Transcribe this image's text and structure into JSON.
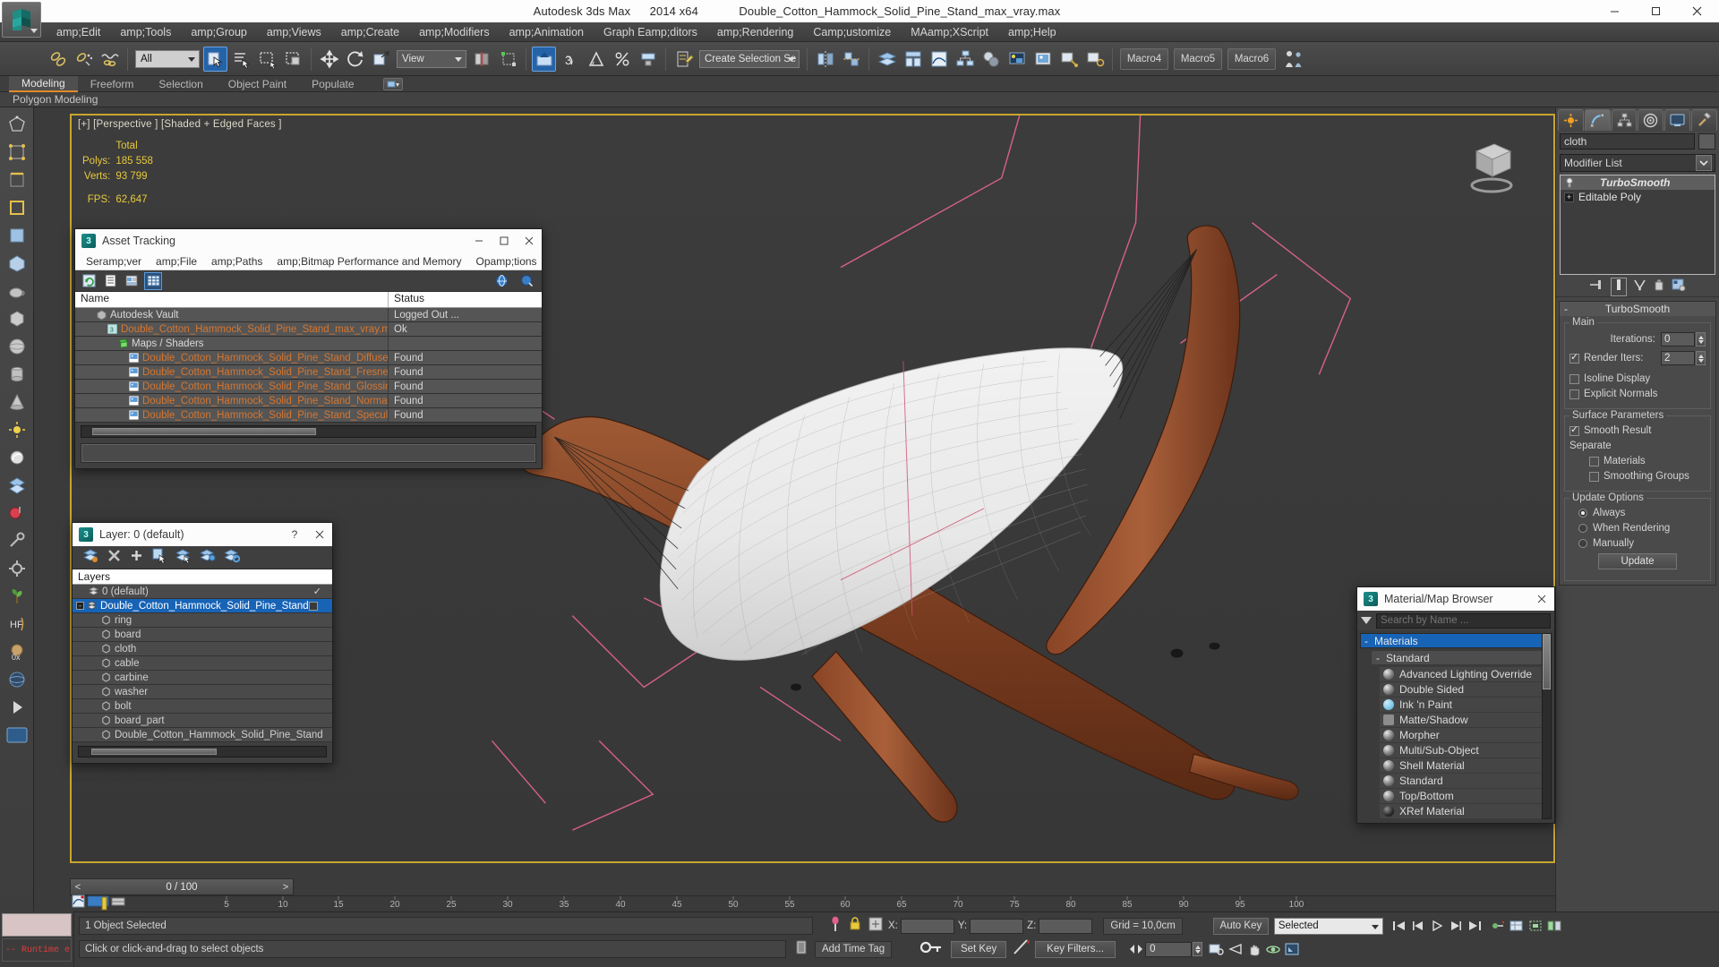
{
  "window": {
    "app_title": "Autodesk 3ds Max",
    "version": "2014 x64",
    "file_title": "Double_Cotton_Hammock_Solid_Pine_Stand_max_vray.max",
    "minimize": "—",
    "maximize": "▢",
    "close": "✕"
  },
  "menubar": {
    "items": [
      "amp;Edit",
      "amp;Tools",
      "amp;Group",
      "amp;Views",
      "amp;Create",
      "amp;Modifiers",
      "amp;Animation",
      "Graph Eamp;ditors",
      "amp;Rendering",
      "Camp;ustomize",
      "MAamp;XScript",
      "amp;Help"
    ]
  },
  "toolbar": {
    "selection_filter": "All",
    "reference_coord": "View",
    "named_selection_placeholder": "Create Selection Se",
    "macro_buttons": [
      "Macro4",
      "Macro5",
      "Macro6"
    ],
    "icons": [
      "link-icon",
      "unlink-icon",
      "bind-space-warp-icon",
      "select-object-icon",
      "select-by-name-icon",
      "rect-selection-region-icon",
      "window-crossing-icon",
      "select-and-move-icon",
      "select-and-rotate-icon",
      "select-and-scale-icon",
      "use-pivot-center-icon",
      "select-and-manipulate-icon",
      "snap-toggle-icon",
      "angle-snap-icon",
      "percent-snap-icon",
      "spinner-snap-icon",
      "edit-named-selection-icon",
      "mirror-icon",
      "align-icon",
      "layer-manager-icon",
      "graphite-tools-icon",
      "curve-editor-icon",
      "schematic-view-icon",
      "material-editor-icon",
      "render-setup-icon",
      "rendered-frame-icon",
      "render-production-icon",
      "render-iterative-icon"
    ]
  },
  "ribbon": {
    "tabs": [
      "Modeling",
      "Freeform",
      "Selection",
      "Object Paint",
      "Populate"
    ],
    "selected_tab": "Modeling",
    "panel_label": "Polygon Modeling"
  },
  "viewport": {
    "label": "[+] [Perspective ] [Shaded + Edged Faces ]",
    "stats": {
      "total_header": "Total",
      "polys_label": "Polys:",
      "polys_value": "185 558",
      "verts_label": "Verts:",
      "verts_value": "93 799",
      "fps_label": "FPS:",
      "fps_value": "62,647"
    }
  },
  "asset_tracking": {
    "title": "Asset Tracking",
    "menus": [
      "Seramp;ver",
      "amp;File",
      "amp;Paths",
      "amp;Bitmap Performance and Memory",
      "Opamp;tions"
    ],
    "columns": {
      "name": "Name",
      "status": "Status"
    },
    "rows": [
      {
        "name": "Autodesk Vault",
        "status": "Logged Out ...",
        "indent": 0,
        "icon": "vault-icon",
        "color": "plain"
      },
      {
        "name": "Double_Cotton_Hammock_Solid_Pine_Stand_max_vray.max",
        "status": "Ok",
        "indent": 1,
        "icon": "max-file-icon",
        "color": "orange"
      },
      {
        "name": "Maps / Shaders",
        "status": "",
        "indent": 2,
        "icon": "maps-icon",
        "color": "plain"
      },
      {
        "name": "Double_Cotton_Hammock_Solid_Pine_Stand_Diffuse.png",
        "status": "Found",
        "indent": 3,
        "icon": "bitmap-icon",
        "color": "orange"
      },
      {
        "name": "Double_Cotton_Hammock_Solid_Pine_Stand_Fresnel.png",
        "status": "Found",
        "indent": 3,
        "icon": "bitmap-icon",
        "color": "orange"
      },
      {
        "name": "Double_Cotton_Hammock_Solid_Pine_Stand_Glossiness.png",
        "status": "Found",
        "indent": 3,
        "icon": "bitmap-icon",
        "color": "orange"
      },
      {
        "name": "Double_Cotton_Hammock_Solid_Pine_Stand_Normal.png",
        "status": "Found",
        "indent": 3,
        "icon": "bitmap-icon",
        "color": "orange"
      },
      {
        "name": "Double_Cotton_Hammock_Solid_Pine_Stand_Specular.png",
        "status": "Found",
        "indent": 3,
        "icon": "bitmap-icon",
        "color": "orange"
      }
    ],
    "toolbar_icons": [
      "refresh-icon",
      "list-view-icon",
      "path-view-icon",
      "table-view-icon"
    ],
    "right_icons": [
      "vault-login-icon",
      "vault-options-icon"
    ]
  },
  "layer_dialog": {
    "title": "Layer: 0 (default)",
    "help": "?",
    "close": "✕",
    "header": "Layers",
    "toolbar_icons": [
      "create-new-layer-icon",
      "delete-layer-icon",
      "add-selection-icon",
      "select-objects-in-layer-icon",
      "highlight-selected-objects-icon",
      "set-current-layer-icon",
      "layer-properties-icon"
    ],
    "rows": [
      {
        "name": "0 (default)",
        "indent": 1,
        "type": "layer",
        "selected": false,
        "current": true
      },
      {
        "name": "Double_Cotton_Hammock_Solid_Pine_Stand",
        "indent": 0,
        "type": "layer",
        "selected": true,
        "expander": "-",
        "checkbox": true
      },
      {
        "name": "ring",
        "indent": 2,
        "type": "object",
        "selected": false
      },
      {
        "name": "board",
        "indent": 2,
        "type": "object",
        "selected": false
      },
      {
        "name": "cloth",
        "indent": 2,
        "type": "object",
        "selected": false
      },
      {
        "name": "cable",
        "indent": 2,
        "type": "object",
        "selected": false
      },
      {
        "name": "carbine",
        "indent": 2,
        "type": "object",
        "selected": false
      },
      {
        "name": "washer",
        "indent": 2,
        "type": "object",
        "selected": false
      },
      {
        "name": "bolt",
        "indent": 2,
        "type": "object",
        "selected": false
      },
      {
        "name": "board_part",
        "indent": 2,
        "type": "object",
        "selected": false
      },
      {
        "name": "Double_Cotton_Hammock_Solid_Pine_Stand",
        "indent": 2,
        "type": "object",
        "selected": false
      }
    ]
  },
  "material_browser": {
    "title": "Material/Map Browser",
    "close": "✕",
    "search_placeholder": "Search by Name ...",
    "group": {
      "expander": "-",
      "label": "Materials"
    },
    "subgroup": {
      "expander": "-",
      "label": "Standard"
    },
    "items": [
      {
        "label": "Advanced Lighting Override",
        "swatch": "sphere"
      },
      {
        "label": "Double Sided",
        "swatch": "sphere"
      },
      {
        "label": "Ink 'n Paint",
        "swatch": "sphere-blue"
      },
      {
        "label": "Matte/Shadow",
        "swatch": "flat-gray"
      },
      {
        "label": "Morpher",
        "swatch": "sphere"
      },
      {
        "label": "Multi/Sub-Object",
        "swatch": "sphere"
      },
      {
        "label": "Shell Material",
        "swatch": "sphere"
      },
      {
        "label": "Standard",
        "swatch": "sphere"
      },
      {
        "label": "Top/Bottom",
        "swatch": "sphere"
      },
      {
        "label": "XRef Material",
        "swatch": "sphere-dark"
      }
    ]
  },
  "command_panel": {
    "tabs": [
      "create-tab",
      "modify-tab",
      "hierarchy-tab",
      "motion-tab",
      "display-tab",
      "utilities-tab"
    ],
    "selected_tab_index": 1,
    "object_name": "cloth",
    "modifier_list_label": "Modifier List",
    "stack": [
      {
        "label": "TurboSmooth",
        "selected": true,
        "icon": "light-bulb-icon"
      },
      {
        "label": "Editable Poly",
        "selected": false,
        "icon": "plus-expander"
      }
    ],
    "rollout": {
      "title": "TurboSmooth",
      "collapse": "-",
      "main_group": "Main",
      "iterations_label": "Iterations:",
      "iterations_value": "0",
      "render_iters_label": "Render Iters:",
      "render_iters_value": "2",
      "render_iters_checked": true,
      "isoline_display_label": "Isoline Display",
      "isoline_display_checked": false,
      "explicit_normals_label": "Explicit Normals",
      "explicit_normals_checked": false,
      "surface_params_group": "Surface Parameters",
      "smooth_result_label": "Smooth Result",
      "smooth_result_checked": true,
      "separate_label": "Separate",
      "materials_label": "Materials",
      "materials_checked": false,
      "smoothing_groups_label": "Smoothing Groups",
      "smoothing_groups_checked": false,
      "update_options_group": "Update Options",
      "update_always": "Always",
      "update_when_rendering": "When Rendering",
      "update_manually": "Manually",
      "update_selected": "Always",
      "update_button": "Update"
    }
  },
  "timeline": {
    "current_frame": "0 / 100",
    "prev": "<",
    "next": ">",
    "ticks": [
      "5",
      "10",
      "15",
      "20",
      "25",
      "30",
      "35",
      "40",
      "45",
      "50",
      "55",
      "60",
      "65",
      "70",
      "75",
      "80",
      "85",
      "90",
      "95",
      "100"
    ]
  },
  "statusbar": {
    "selection_text": "1 Object Selected",
    "prompt_text": "Click or click-and-drag to select objects",
    "x_label": "X:",
    "x_value": "",
    "y_label": "Y:",
    "y_value": "",
    "z_label": "Z:",
    "z_value": "",
    "grid_text": "Grid = 10,0cm",
    "add_time_tag": "Add Time Tag",
    "auto_key": "Auto Key",
    "set_key": "Set Key",
    "key_mode": "Selected",
    "key_filters": "Key Filters...",
    "key_frame_value": "0",
    "maxscript_error": "-- Runtime e"
  }
}
